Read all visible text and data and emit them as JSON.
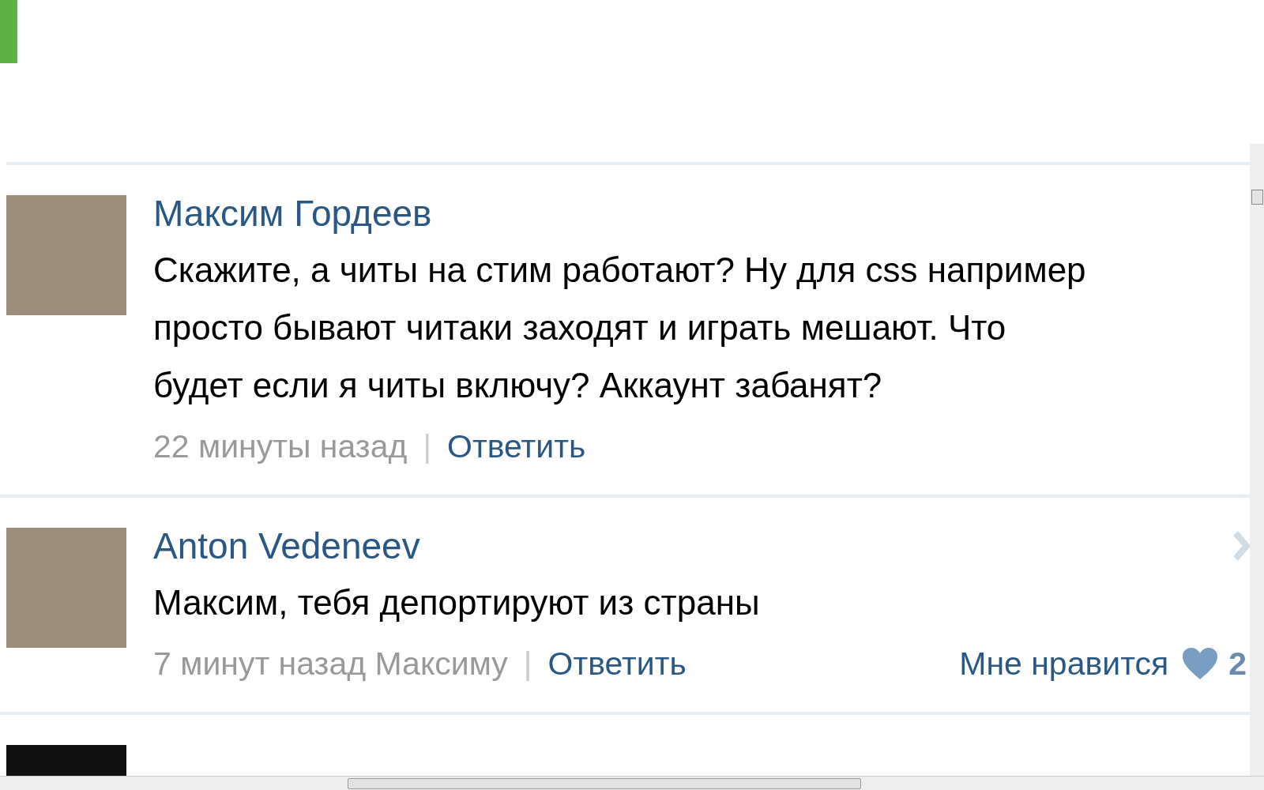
{
  "comments": [
    {
      "author": "Максим Гордеев",
      "text": "Скажите, а читы на стим работают? Ну для css например\nпросто бывают читаки заходят и играть мешают. Что\nбудет если я читы включу? Аккаунт забанят?",
      "time": "22 минуты назад",
      "separator": "|",
      "reply": "Ответить"
    },
    {
      "author": "Anton Vedeneev",
      "text": "Максим, тебя депортируют из страны",
      "time": "7 минут назад Максиму",
      "separator": "|",
      "reply": "Ответить",
      "like": {
        "label": "Мне нравится",
        "count": "2"
      }
    }
  ]
}
